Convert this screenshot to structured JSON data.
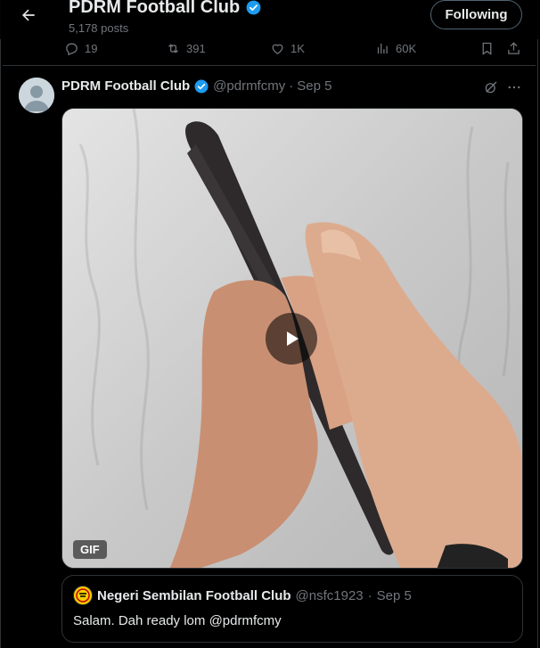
{
  "header": {
    "title": "PDRM Football Club",
    "post_count": "5,178 posts",
    "follow_label": "Following"
  },
  "prev_actions": {
    "replies": "19",
    "reposts": "391",
    "likes": "1K",
    "views": "60K"
  },
  "tweet": {
    "author_name": "PDRM Football Club",
    "handle": "@pdrmfcmy",
    "dot": "·",
    "date": "Sep 5",
    "media_badge": "GIF",
    "quote": {
      "author_name": "Negeri Sembilan Football Club",
      "handle": "@nsfc1923",
      "dot": "·",
      "date": "Sep 5",
      "text": "Salam. Dah ready lom @pdrmfcmy"
    }
  },
  "colors": {
    "accent": "#1d9bf0",
    "muted": "#71767b",
    "border": "#2f3336"
  },
  "icons": [
    "back-arrow-icon",
    "verified-badge-icon",
    "reply-icon",
    "repost-icon",
    "like-icon",
    "views-icon",
    "bookmark-icon",
    "share-icon",
    "grok-icon",
    "more-icon",
    "play-icon"
  ]
}
